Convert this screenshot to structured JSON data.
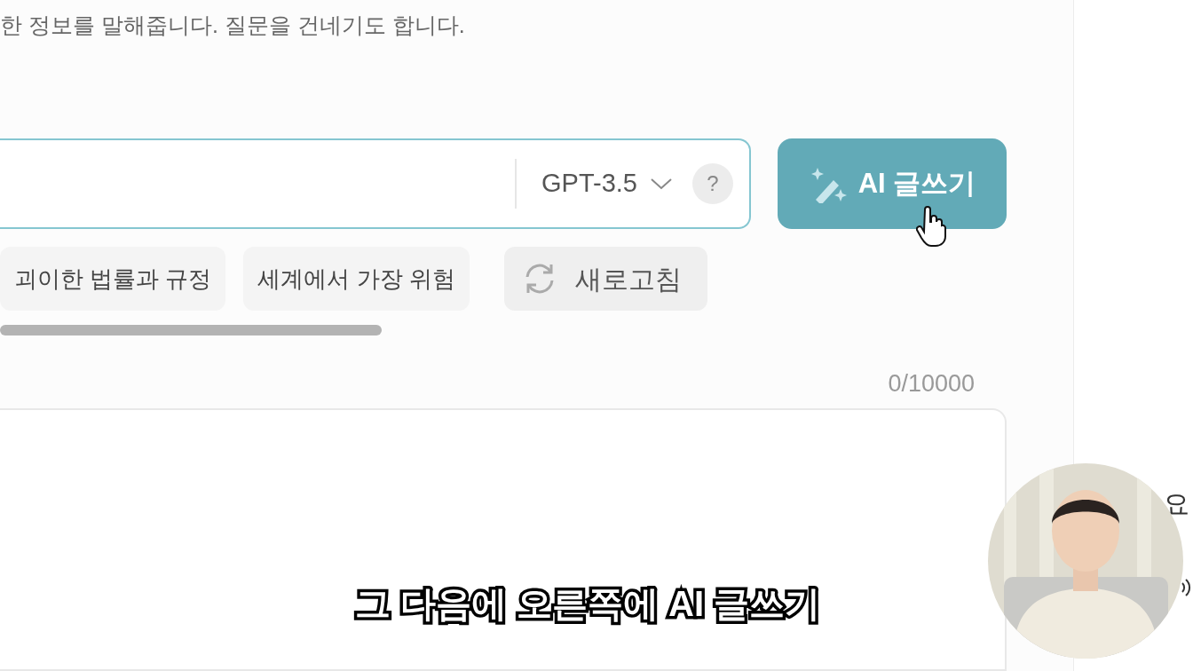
{
  "description": "한 정보를 말해줍니다. 질문을 건네기도 합니다.",
  "prompt_field": {
    "model": "GPT-3.5",
    "help": "?"
  },
  "write_button": {
    "label": "AI 글쓰기"
  },
  "suggestions": [
    {
      "label": "괴이한 법률과 규정"
    },
    {
      "label": "세계에서 가장 위험"
    }
  ],
  "refresh_button": {
    "label": "새로고침"
  },
  "counter": "0/10000",
  "side_panel": {
    "text": "요"
  },
  "subtitle": "그 다음에 오른쪽에 AI 글쓰기"
}
